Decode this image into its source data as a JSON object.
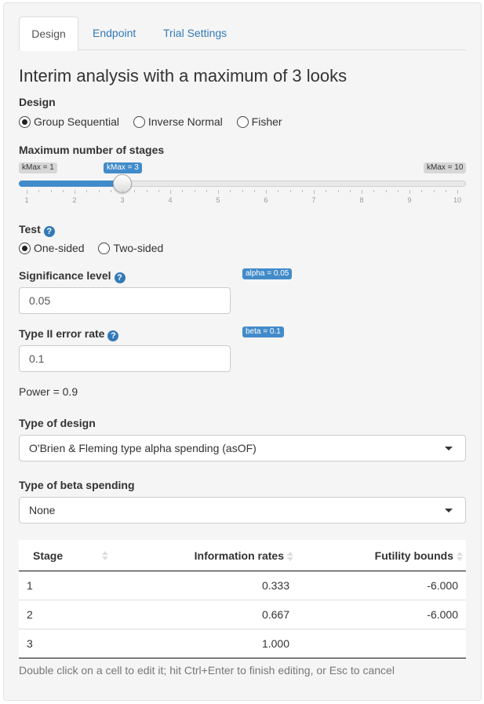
{
  "tabs": [
    {
      "label": "Design",
      "active": true
    },
    {
      "label": "Endpoint",
      "active": false
    },
    {
      "label": "Trial Settings",
      "active": false
    }
  ],
  "heading": "Interim analysis with a maximum of 3 looks",
  "design": {
    "label": "Design",
    "options": [
      "Group Sequential",
      "Inverse Normal",
      "Fisher"
    ],
    "selected": "Group Sequential"
  },
  "stages": {
    "label": "Maximum number of stages",
    "min_label": "kMax = 1",
    "max_label": "kMax = 10",
    "value_label": "kMax = 3",
    "min": 1,
    "max": 10,
    "value": 3,
    "ticks": [
      "1",
      "2",
      "3",
      "4",
      "5",
      "6",
      "7",
      "8",
      "9",
      "10"
    ]
  },
  "test": {
    "label": "Test",
    "options": [
      "One-sided",
      "Two-sided"
    ],
    "selected": "One-sided"
  },
  "significance": {
    "label": "Significance level",
    "value": "0.05",
    "badge": "alpha = 0.05"
  },
  "type2": {
    "label": "Type II error rate",
    "value": "0.1",
    "badge": "beta = 0.1"
  },
  "power_text": "Power = 0.9",
  "design_type": {
    "label": "Type of design",
    "selected": "O'Brien & Fleming type alpha spending (asOF)"
  },
  "beta_spending": {
    "label": "Type of beta spending",
    "selected": "None"
  },
  "table": {
    "headers": [
      "Stage",
      "Information rates",
      "Futility bounds"
    ],
    "rows": [
      [
        "1",
        "0.333",
        "-6.000"
      ],
      [
        "2",
        "0.667",
        "-6.000"
      ],
      [
        "3",
        "1.000",
        ""
      ]
    ]
  },
  "table_note": "Double click on a cell to edit it; hit Ctrl+Enter to finish editing, or Esc to cancel",
  "colors": {
    "accent": "#428bca",
    "link": "#337ab7"
  }
}
